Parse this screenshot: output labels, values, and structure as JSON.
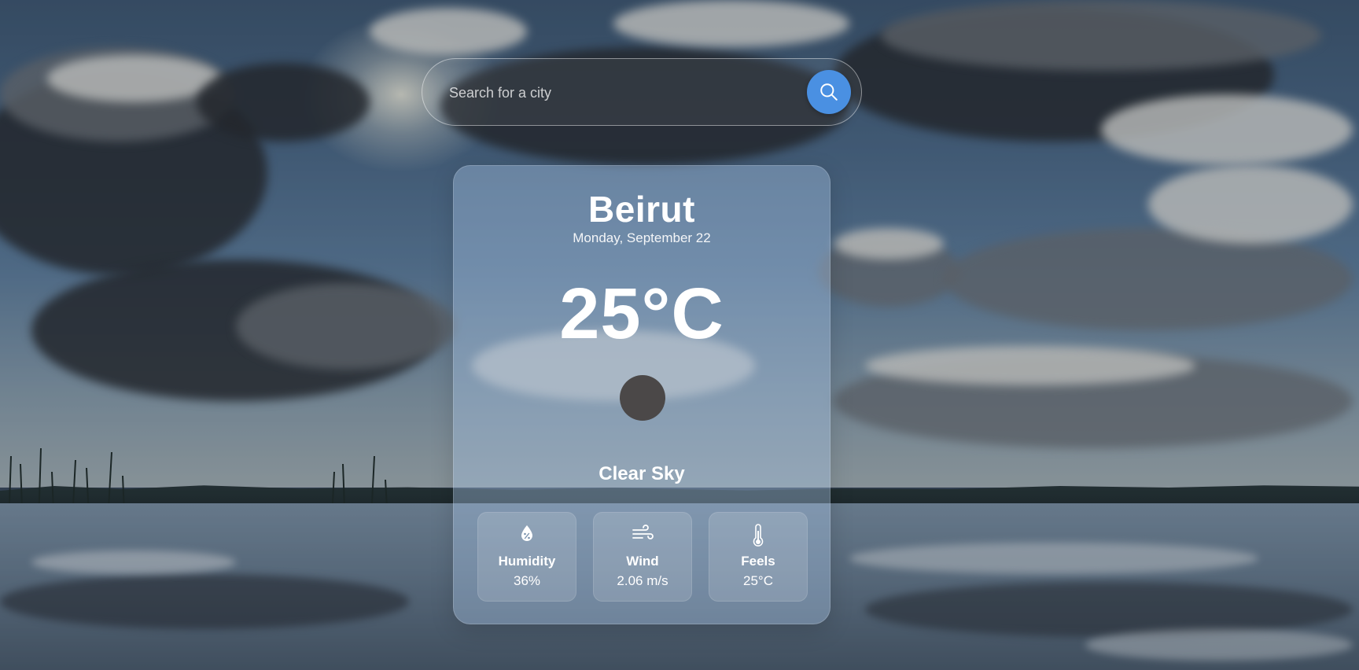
{
  "search": {
    "placeholder": "Search for a city",
    "button_icon": "search-icon"
  },
  "weather": {
    "city": "Beirut",
    "date": "Monday, September 22",
    "temperature": "25°C",
    "condition_icon": "weather-condition-icon",
    "description": "Clear Sky"
  },
  "stats": [
    {
      "icon": "humidity-icon",
      "label": "Humidity",
      "value": "36%"
    },
    {
      "icon": "wind-icon",
      "label": "Wind",
      "value": "2.06 m/s"
    },
    {
      "icon": "thermometer-icon",
      "label": "Feels",
      "value": "25°C"
    }
  ],
  "colors": {
    "accent": "#4a90e2",
    "card_bg": "rgba(170,200,235,0.38)",
    "text": "#ffffff"
  }
}
